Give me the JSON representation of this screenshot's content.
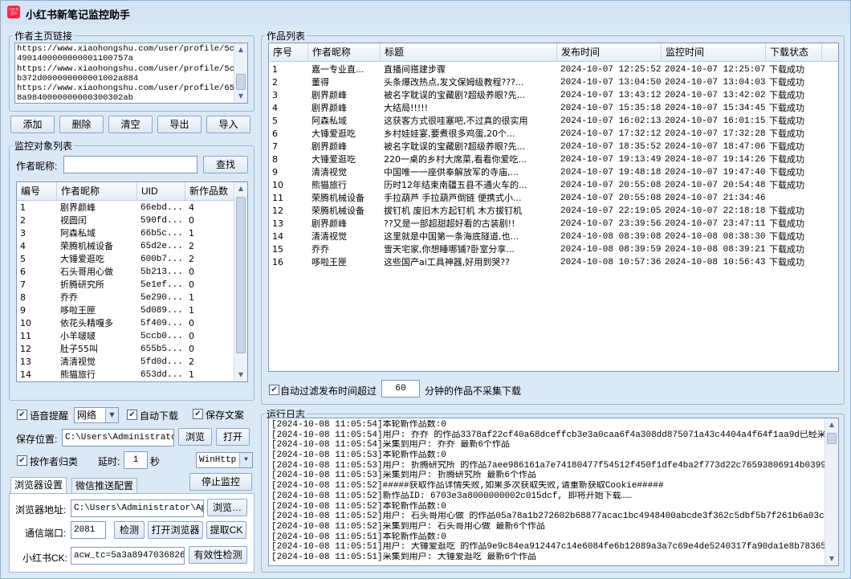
{
  "app": {
    "title": "小红书新笔记监控助手",
    "logo_text": "小红书 蓝书"
  },
  "author_links": {
    "legend": "作者主页链接",
    "lines": [
      "https://www.xiaohongshu.com/user/profile/5ca",
      "4901400000000001100757a",
      "https://www.xiaohongshu.com/user/profile/5c9",
      "b372d000000000001002a884",
      "https://www.xiaohongshu.com/user/profile/654",
      "8a9840000000000300302ab"
    ]
  },
  "link_buttons": {
    "add": "添加",
    "delete": "删除",
    "clear": "清空",
    "export": "导出",
    "import": "导入"
  },
  "monitor": {
    "legend": "监控对象列表",
    "nickname_label": "作者昵称:",
    "nickname_value": "",
    "search": "查找",
    "columns": [
      "编号",
      "作者昵称",
      "UID",
      "新作品数"
    ],
    "rows": [
      [
        "1",
        "剧界颜峰",
        "66ebd...",
        "4"
      ],
      [
        "2",
        "视圆闰",
        "590fd...",
        "0"
      ],
      [
        "3",
        "阿森私域",
        "66b5c...",
        "1"
      ],
      [
        "4",
        "荣腾机械设备",
        "65d2e...",
        "2"
      ],
      [
        "5",
        "大锤爱逛吃",
        "600b7...",
        "2"
      ],
      [
        "6",
        "石头哥用心做",
        "5b213...",
        "0"
      ],
      [
        "7",
        "折腾研究所",
        "5e1ef...",
        "0"
      ],
      [
        "8",
        "乔乔",
        "5e290...",
        "1"
      ],
      [
        "9",
        "哆啦王匣",
        "5d089...",
        "1"
      ],
      [
        "10",
        "依花头精嘎多",
        "5f409...",
        "0"
      ],
      [
        "11",
        "小羊啵啵",
        "5ccb0...",
        "0"
      ],
      [
        "12",
        "肚子55叫",
        "655b5...",
        "0"
      ],
      [
        "13",
        "清清视觉",
        "5fd0d...",
        "2"
      ],
      [
        "14",
        "熊猫旅行",
        "653dd...",
        "1"
      ]
    ]
  },
  "options": {
    "voice_alert": "语音提醒",
    "voice_alert_checked": true,
    "voice_source": "网络",
    "auto_download": "自动下载",
    "auto_download_checked": true,
    "save_text": "保存文案",
    "save_text_checked": true,
    "save_path_label": "保存位置:",
    "save_path_value": "C:\\Users\\Administrator\\",
    "browse": "浏览",
    "open": "打开",
    "by_author": "按作者归类",
    "by_author_checked": true,
    "delay_label": "延时:",
    "delay_value": "1",
    "delay_unit": "秒",
    "http_engine": "WinHttp"
  },
  "tabs": [
    "浏览器设置",
    "微信推送配置"
  ],
  "stop_monitor": "停止监控",
  "browser": {
    "address_label": "浏览器地址:",
    "address_value": "C:\\Users\\Administrator\\AppI",
    "browse": "浏览…",
    "port_label": "通信端口:",
    "port_value": "2081",
    "detect": "检测",
    "open_browser": "打开浏览器",
    "get_ck": "提取CK",
    "ck_label": "小红书CK:",
    "ck_value": "acw_tc=5a3a89470368264d",
    "validate": "有效性检测"
  },
  "works": {
    "legend": "作品列表",
    "columns": [
      "序号",
      "作者昵称",
      "标题",
      "发布时间",
      "监控时间",
      "下载状态"
    ],
    "rows": [
      [
        "1",
        "嘉一专业直...",
        "直播间搭建步骤",
        "2024-10-07 12:25:52",
        "2024-10-07 12:25:07",
        "下载成功"
      ],
      [
        "2",
        "董得",
        "头条爆改热点,发文保姆级教程???...",
        "2024-10-07 13:04:50",
        "2024-10-07 13:04:03",
        "下载成功"
      ],
      [
        "3",
        "剧界颜峰",
        "被名字耽误的宝藏剧?超级养眼?先...",
        "2024-10-07 13:43:12",
        "2024-10-07 13:42:02",
        "下载成功"
      ],
      [
        "4",
        "剧界颜峰",
        "大结局!!!!!",
        "2024-10-07 15:35:18",
        "2024-10-07 15:34:45",
        "下载成功"
      ],
      [
        "5",
        "阿森私域",
        "这获客方式很哇塞吧,不过真的很实用",
        "2024-10-07 16:02:13",
        "2024-10-07 16:01:15",
        "下载成功"
      ],
      [
        "6",
        "大锤爱逛吃",
        "乡村娃娃宴,要煮很多鸡蛋,20个...",
        "2024-10-07 17:32:12",
        "2024-10-07 17:32:28",
        "下载成功"
      ],
      [
        "7",
        "剧界颜峰",
        "被名字耽误的宝藏剧?超级养眼?先...",
        "2024-10-07 18:35:52",
        "2024-10-07 18:47:06",
        "下载成功"
      ],
      [
        "8",
        "大锤爱逛吃",
        "220一桌的乡村大席菜,看看你爱吃...",
        "2024-10-07 19:13:49",
        "2024-10-07 19:14:26",
        "下载成功"
      ],
      [
        "9",
        "清清视觉",
        "中国唯一一座供奉解放军的寺庙,...",
        "2024-10-07 19:48:18",
        "2024-10-07 19:47:40",
        "下载成功"
      ],
      [
        "10",
        "熊猫旅行",
        "历时12年结束南疆五县不通火车的...",
        "2024-10-07 20:55:08",
        "2024-10-07 20:54:48",
        "下载成功"
      ],
      [
        "11",
        "荣腾机械设备",
        "手拉葫芦 手拉葫芦倒链 便携式小...",
        "2024-10-07 20:55:08",
        "2024-10-07 21:34:46",
        ""
      ],
      [
        "12",
        "荣腾机械设备",
        "拔钉机 废旧木方起钉机 木方拔钉机",
        "2024-10-07 22:19:05",
        "2024-10-07 22:18:18",
        "下载成功"
      ],
      [
        "13",
        "剧界颜峰",
        "??又是一部超甜超好看的古装剧!!",
        "2024-10-07 23:39:56",
        "2024-10-07 23:47:11",
        "下载成功"
      ],
      [
        "14",
        "清清视觉",
        "这里就是中国第一条海底隧道,也...",
        "2024-10-08 08:39:08",
        "2024-10-08 08:38:30",
        "下载成功"
      ],
      [
        "15",
        "乔乔",
        "雪天宅家,你想睡哪铺?卧室分享...",
        "2024-10-08 08:39:59",
        "2024-10-08 08:39:21",
        "下载成功"
      ],
      [
        "16",
        "哆啦王匣",
        "这些国产ai工具神器,好用到哭??",
        "2024-10-08 10:57:36",
        "2024-10-08 10:56:43",
        "下载成功"
      ]
    ]
  },
  "filter": {
    "checked": true,
    "prefix": "自动过滤发布时间超过",
    "minutes": "60",
    "suffix": "分钟的作品不采集下载"
  },
  "log": {
    "legend": "运行日志",
    "lines": [
      "[2024-10-08 11:05:54]本轮新作品数:0",
      "[2024-10-08 11:05:54]用户: 乔乔 的作品3378af22cf40a68dceffcb3e3a0caa6f4a308dd875071a43c4404a4f64f1aa9d已经采集过了",
      "[2024-10-08 11:05:54]采集到用户: 乔乔 最新6个作品",
      "[2024-10-08 11:05:53]本轮新作品数:0",
      "[2024-10-08 11:05:53]用户: 折腾研究所 的作品7aee986161a7e74180477f54512f450f1dfe4ba2f773d22c76593806914b0399已经采集",
      "[2024-10-08 11:05:53]采集到用户: 折腾研究所 最新6个作品",
      "[2024-10-08 11:05:52]#####获取作品详情失败,如果多次获取失败,请重新获取Cookie#####",
      "[2024-10-08 11:05:52]新作品ID: 6703e3a8000000002c015dcf, 即将开始下载……",
      "[2024-10-08 11:05:52]本轮新作品数:0",
      "[2024-10-08 11:05:52]用户: 石头哥用心做 的作品05a78a1b272602b68877acac1bc4948400abcde3f362c5dbf5b7f261b6a03c2a已经",
      "[2024-10-08 11:05:52]采集到用户: 石头哥用心做 最新6个作品",
      "[2024-10-08 11:05:51]本轮新作品数:0",
      "[2024-10-08 11:05:51]用户: 大锤爱逛吃 的作品9e9c84ea912447c14e6084fe6b12089a3a7c69e4de5240317fa90da1e8b78365已经采集",
      "[2024-10-08 11:05:51]采集到用户: 大锤爱逛吃 最新6个作品"
    ]
  }
}
